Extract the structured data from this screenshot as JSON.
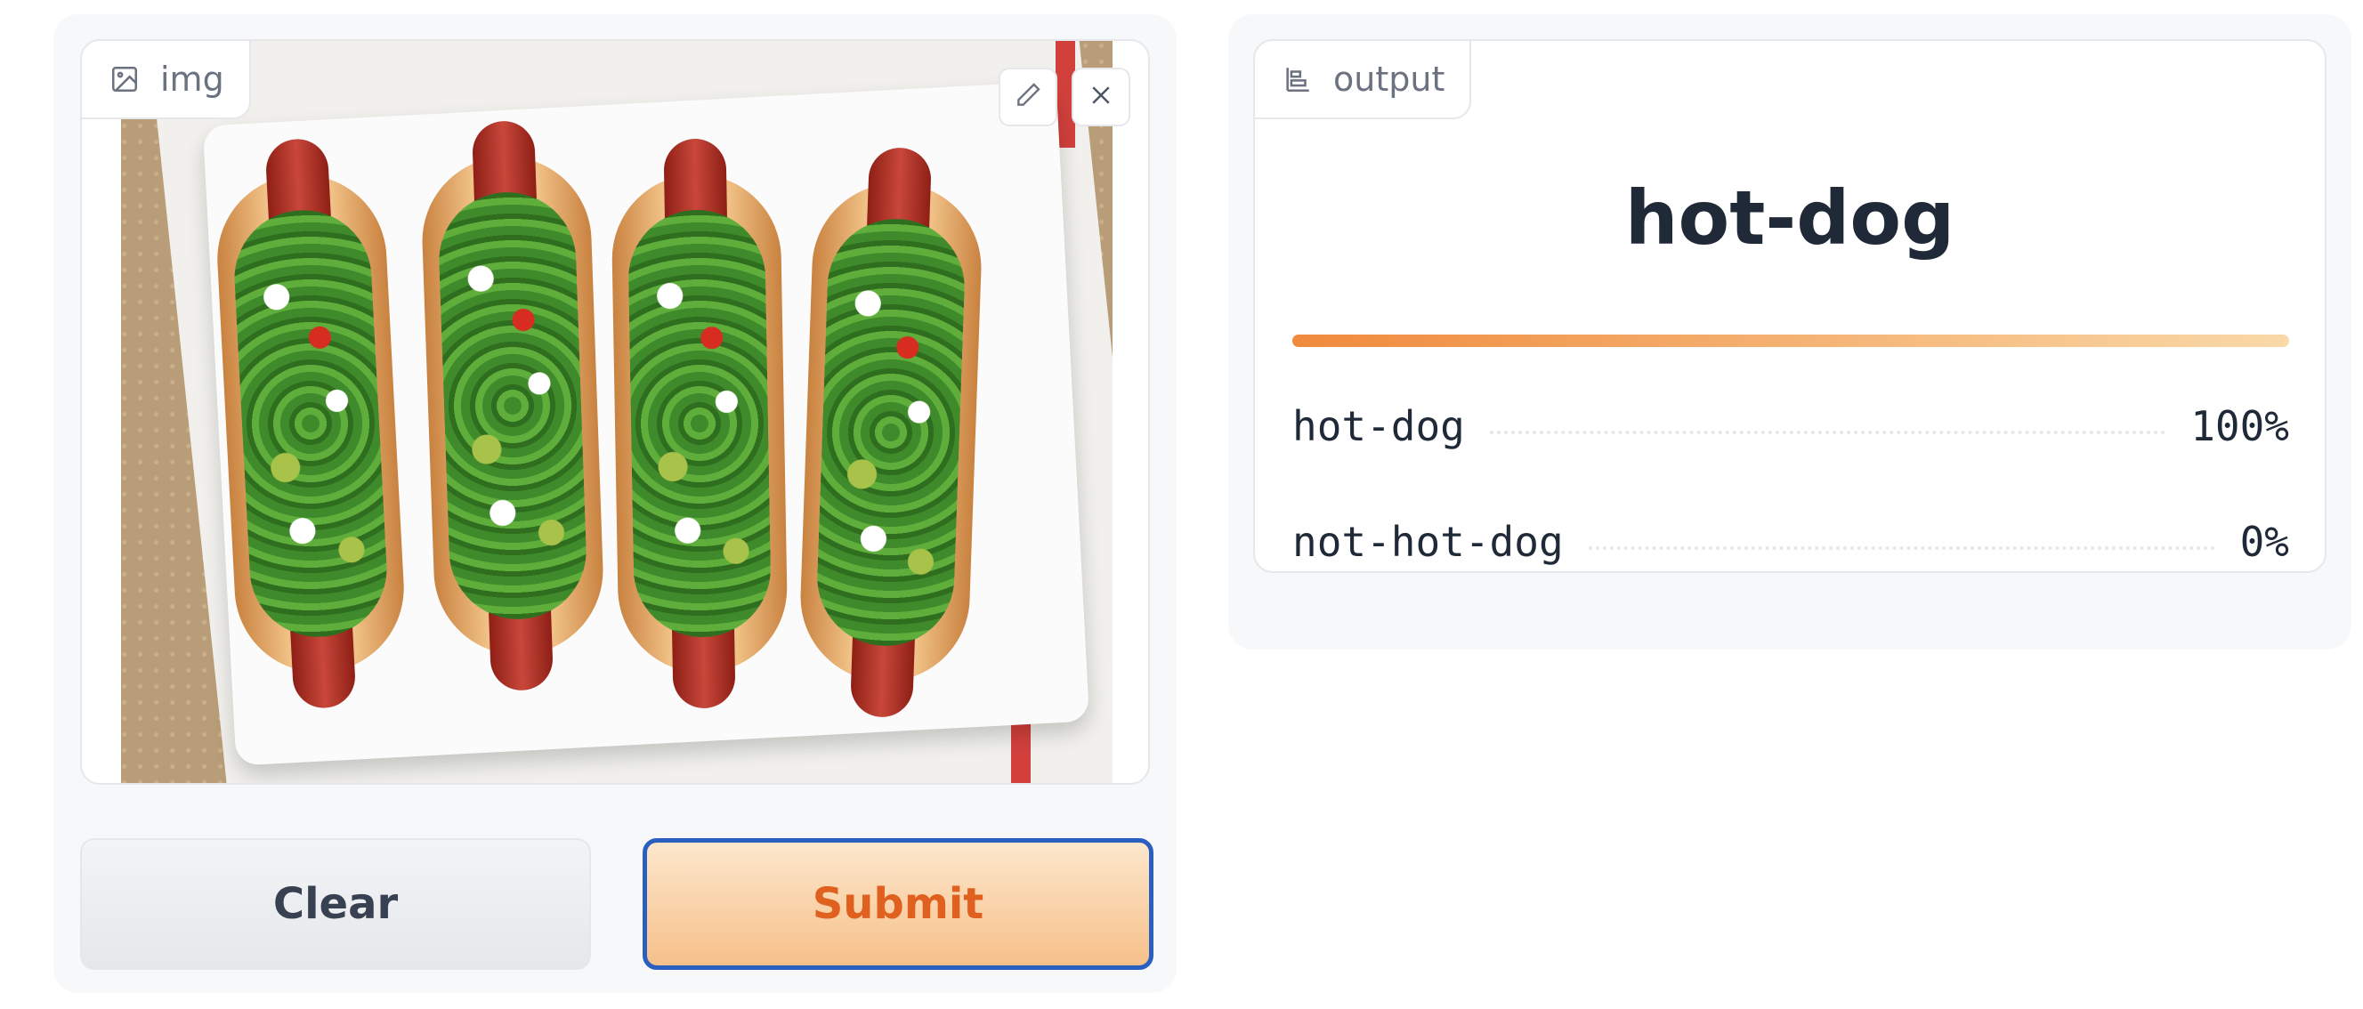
{
  "input": {
    "label": "img",
    "label_icon": "image-icon",
    "edit_icon": "pencil-icon",
    "close_icon": "close-icon",
    "image_alt": "hot dogs with toppings on a white plate"
  },
  "buttons": {
    "clear": "Clear",
    "submit": "Submit"
  },
  "output": {
    "label": "output",
    "label_icon": "bar-chart-icon",
    "prediction": "hot-dog",
    "top_confidence": 1.0,
    "rows": [
      {
        "label": "hot-dog",
        "value": "100%"
      },
      {
        "label": "not-hot-dog",
        "value": "0%"
      }
    ]
  },
  "colors": {
    "accent_orange": "#e0601f",
    "submit_border": "#2b5fbf",
    "bar_start": "#f08a3c",
    "bar_end": "#f9d9a8"
  }
}
